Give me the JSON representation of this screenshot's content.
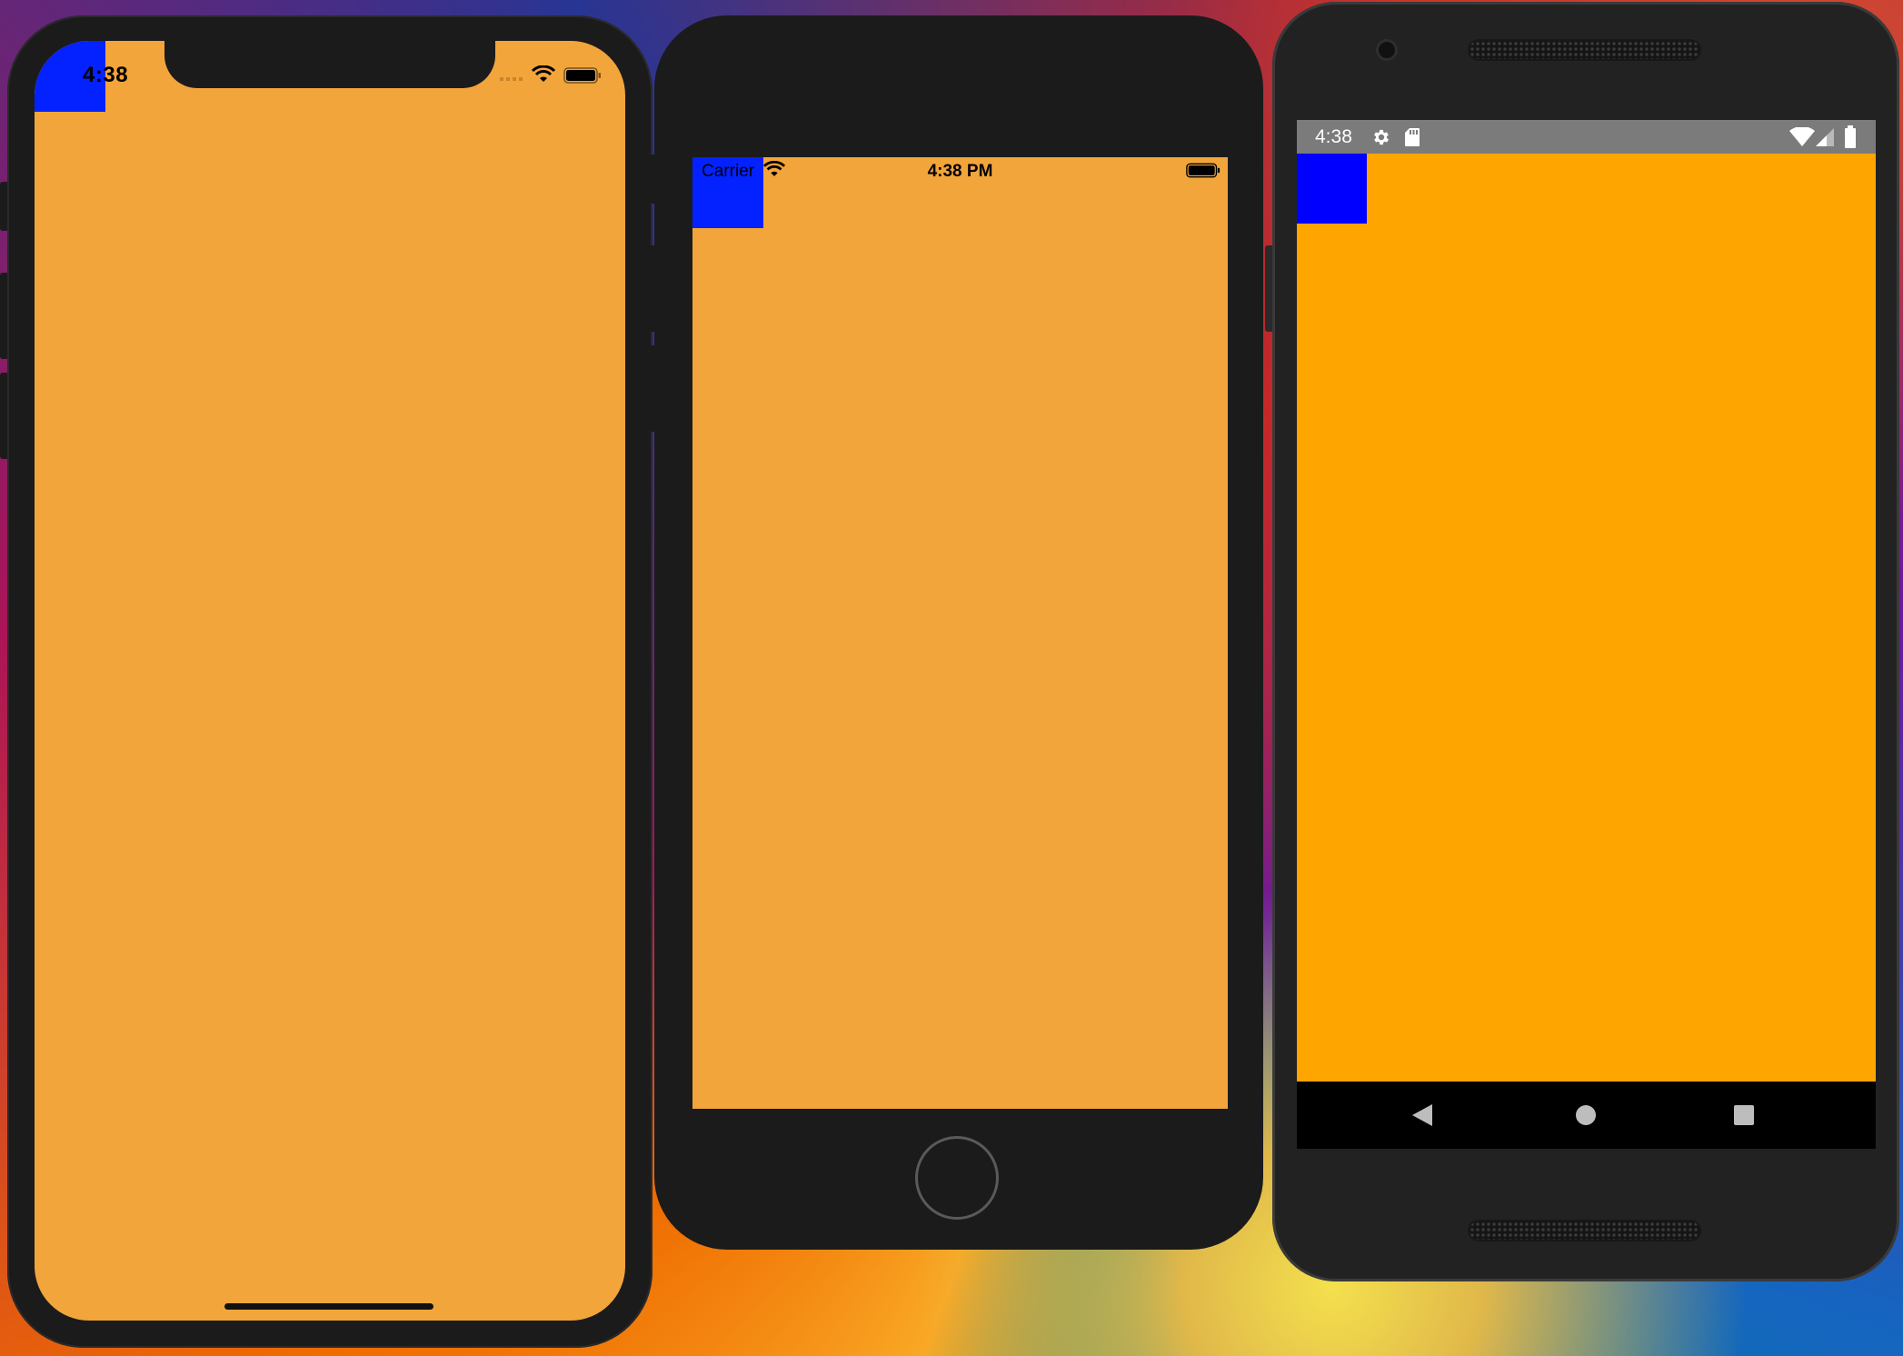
{
  "iphone_x": {
    "status_time": "4:38",
    "colors": {
      "screen": "#f2a53b",
      "box": "#0422ff"
    }
  },
  "iphone_8": {
    "carrier": "Carrier",
    "status_time": "4:38 PM",
    "colors": {
      "screen": "#f2a53b",
      "box": "#0422ff"
    }
  },
  "android": {
    "status_time": "4:38",
    "status_icons": [
      "settings-icon",
      "sd-card-icon",
      "wifi-icon",
      "signal-icon",
      "battery-icon"
    ],
    "nav_icons": [
      "back-icon",
      "home-icon",
      "recents-icon"
    ],
    "colors": {
      "status_bar": "#7b7b7b",
      "screen": "#ffa500",
      "box": "#0000ff",
      "nav_bar": "#000000"
    }
  }
}
